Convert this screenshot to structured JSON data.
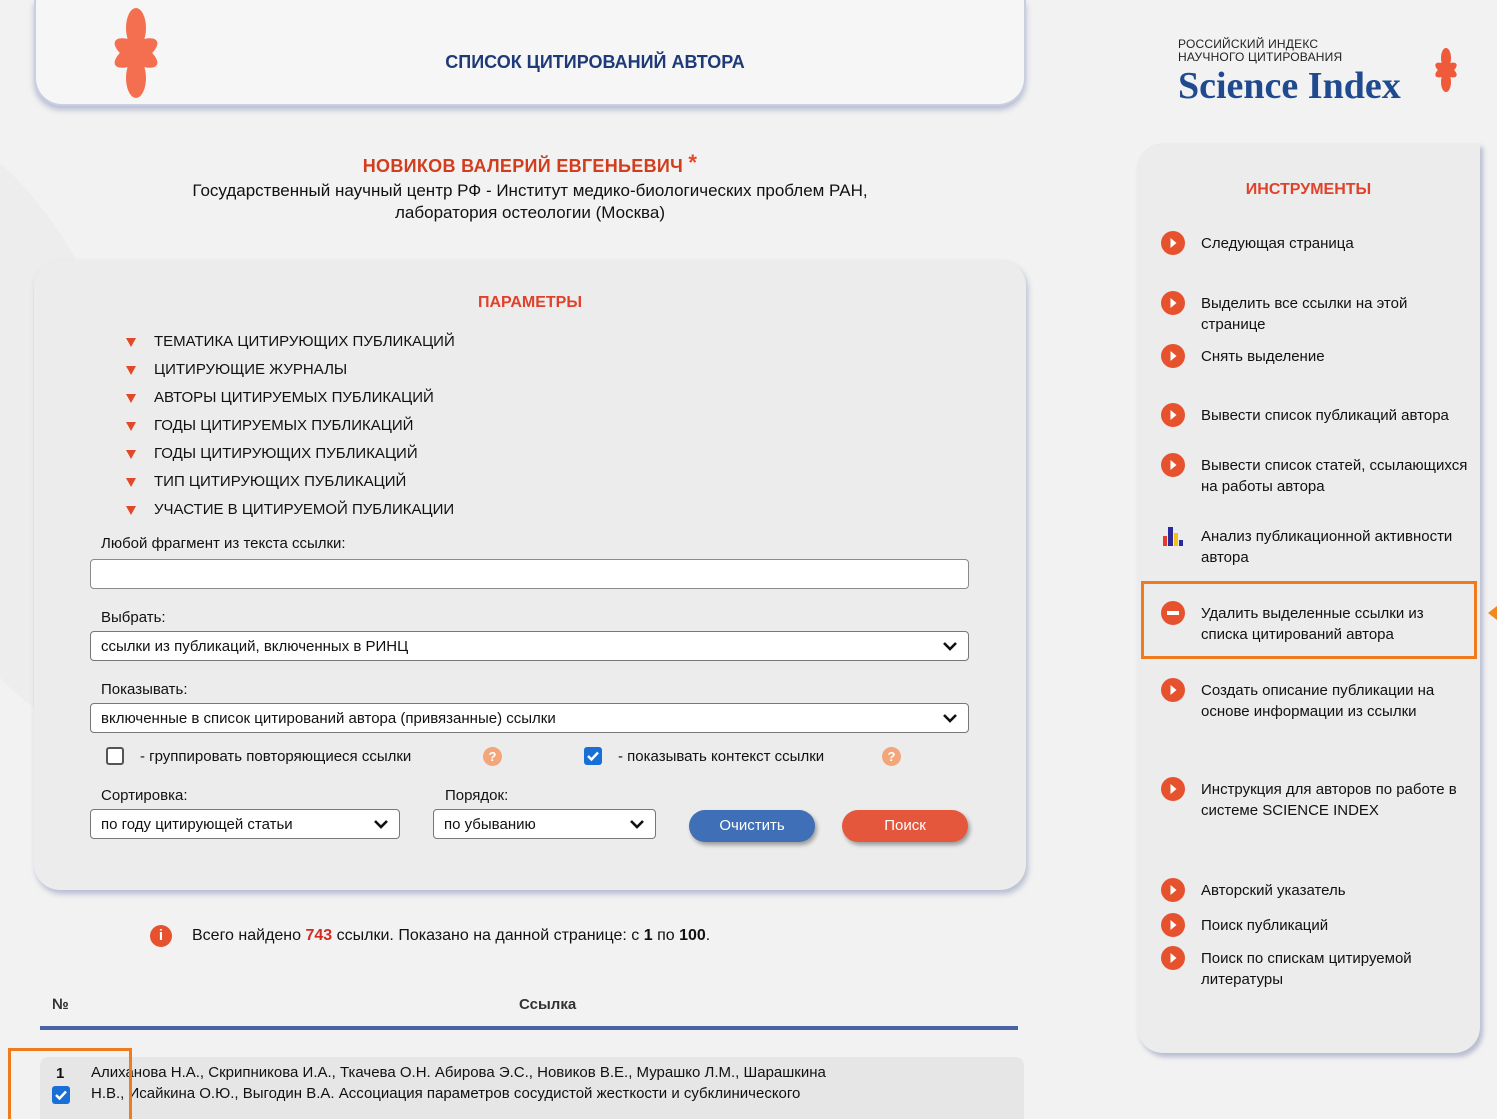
{
  "header": {
    "title": "СПИСОК ЦИТИРОВАНИЙ АВТОРА"
  },
  "logo": {
    "line1": "РОССИЙСКИЙ ИНДЕКС",
    "line2": "НАУЧНОГО ЦИТИРОВАНИЯ",
    "brand": "Science Index"
  },
  "author": {
    "name": "НОВИКОВ ВАЛЕРИЙ ЕВГЕНЬЕВИЧ",
    "asterisk": "*",
    "org_line1": "Государственный научный центр РФ - Институт медико-биологических проблем РАН,",
    "org_line2": "лаборатория остеологии (Москва)"
  },
  "params": {
    "title": "ПАРАМЕТРЫ",
    "filters": [
      "ТЕМАТИКА ЦИТИРУЮЩИХ ПУБЛИКАЦИЙ",
      "ЦИТИРУЮЩИЕ ЖУРНАЛЫ",
      "АВТОРЫ ЦИТИРУЕМЫХ ПУБЛИКАЦИЙ",
      "ГОДЫ ЦИТИРУЕМЫХ ПУБЛИКАЦИЙ",
      "ГОДЫ ЦИТИРУЮЩИХ ПУБЛИКАЦИЙ",
      "ТИП ЦИТИРУЮЩИХ ПУБЛИКАЦИЙ",
      "УЧАСТИЕ В ЦИТИРУЕМОЙ ПУБЛИКАЦИИ"
    ],
    "text_label": "Любой фрагмент из текста ссылки:",
    "text_value": "",
    "select_label": "Выбрать:",
    "select_value": "ссылки из публикаций, включенных в РИНЦ",
    "show_label": "Показывать:",
    "show_value": "включенные в список цитирований автора (привязанные) ссылки",
    "group_label": "- группировать повторяющиеся ссылки",
    "group_checked": false,
    "context_label": "- показывать контекст ссылки",
    "context_checked": true,
    "help_glyph": "?",
    "sort_label": "Сортировка:",
    "sort_value": "по году цитирующей статьи",
    "order_label": "Порядок:",
    "order_value": "по убыванию",
    "clear_button": "Очистить",
    "search_button": "Поиск"
  },
  "summary": {
    "info_glyph": "i",
    "prefix": "Всего найдено",
    "total": "743",
    "middle": "ссылки. Показано на данной странице: с",
    "from": "1",
    "to_word": "по",
    "to": "100",
    "end": "."
  },
  "table": {
    "col_num": "№",
    "col_link": "Ссылка",
    "rows": [
      {
        "num": "1",
        "line1": "Алиханова Н.А., Скрипникова И.А., Ткачева О.Н. Абирова Э.С., Новиков В.Е., Мурашко Л.М., Шарашкина",
        "line2": "Н.В., Исайкина О.Ю., Выгодин В.А. Ассоциация параметров сосудистой жесткости и субклинического",
        "checked": true
      }
    ]
  },
  "tools": {
    "title": "ИНСТРУМЕНТЫ",
    "items": [
      {
        "icon": "arrow-circle-icon",
        "label": "Следующая страница"
      },
      {
        "icon": "arrow-circle-icon",
        "label": "Выделить все ссылки на этой странице"
      },
      {
        "icon": "arrow-circle-icon",
        "label": "Снять выделение"
      },
      {
        "icon": "arrow-circle-icon",
        "label": "Вывести список публикаций автора"
      },
      {
        "icon": "arrow-circle-icon",
        "label": "Вывести список статей, ссылающихся на работы автора"
      },
      {
        "icon": "bar-chart-icon",
        "label": "Анализ публикационной активности автора"
      },
      {
        "icon": "minus-circle-icon",
        "label": "Удалить выделенные ссылки из списка цитирований автора"
      },
      {
        "icon": "arrow-circle-icon",
        "label": "Создать описание публикации на основе информации из ссылки"
      },
      {
        "icon": "arrow-circle-icon",
        "label": "Инструкция для авторов по работе в системе SCIENCE INDEX"
      },
      {
        "icon": "arrow-circle-icon",
        "label": "Авторский указатель"
      },
      {
        "icon": "arrow-circle-icon",
        "label": "Поиск публикаций"
      },
      {
        "icon": "arrow-circle-icon",
        "label": "Поиск по спискам цитируемой литературы"
      }
    ]
  },
  "colors": {
    "accent_red": "#e0412a",
    "brand_blue": "#1f4a8f",
    "highlight_orange": "#f07a1e",
    "button_blue": "#3f6fb6",
    "button_red": "#e4573d"
  }
}
